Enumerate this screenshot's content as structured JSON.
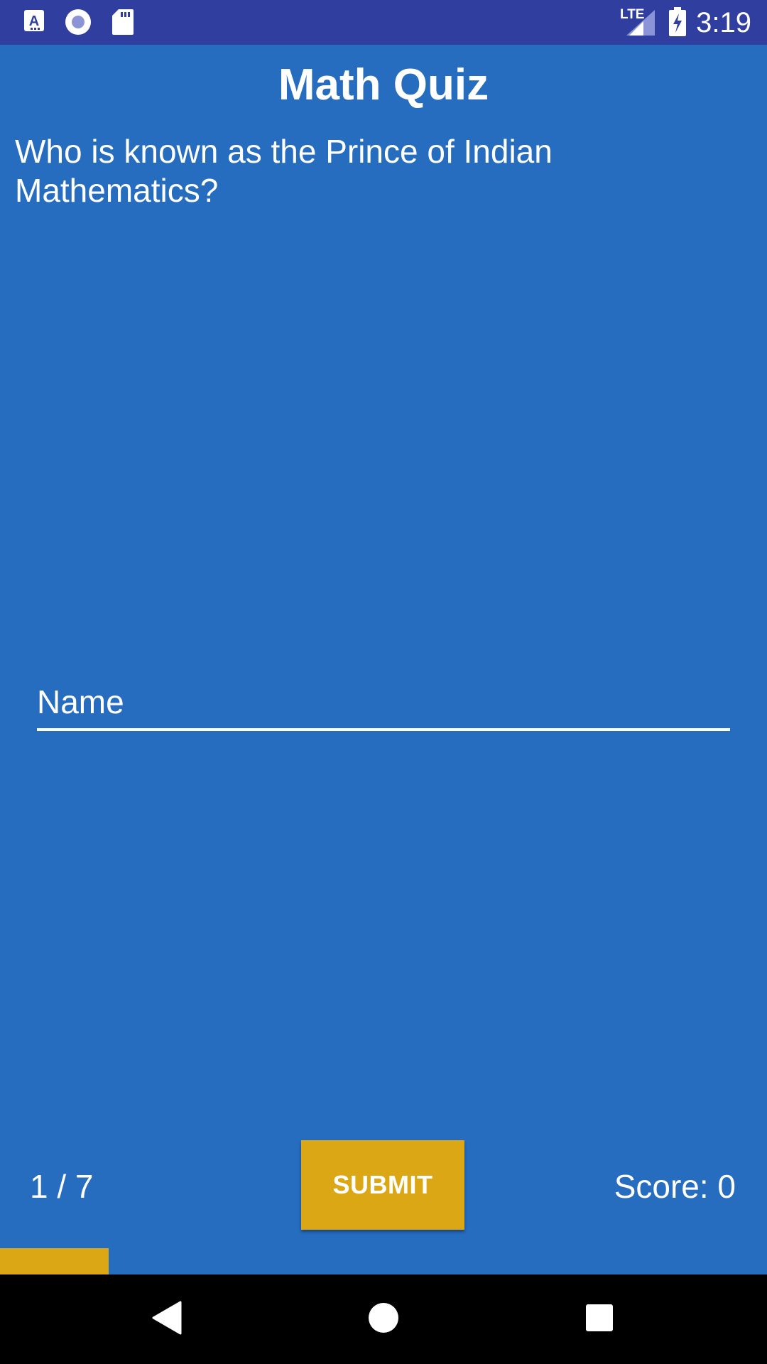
{
  "status_bar": {
    "time": "3:19",
    "network": "LTE",
    "icons": [
      "a-accessibility-icon",
      "radio-circle-icon",
      "sd-card-icon",
      "lte-signal-icon",
      "battery-charging-icon"
    ]
  },
  "app": {
    "title": "Math Quiz",
    "question": "Who is known as the Prince of Indian Mathematics?",
    "answer_input": {
      "placeholder": "Name",
      "value": ""
    },
    "counter": "1 / 7",
    "submit_label": "SUBMIT",
    "score": "Score: 0",
    "progress": {
      "current": 1,
      "total": 7,
      "fraction": 0.142
    }
  },
  "nav_bar": {
    "buttons": [
      "back-icon",
      "home-icon",
      "recents-icon"
    ]
  },
  "colors": {
    "background": "#266cbf",
    "status_bar": "#303f9f",
    "accent": "#dba714",
    "text": "#ffffff"
  }
}
